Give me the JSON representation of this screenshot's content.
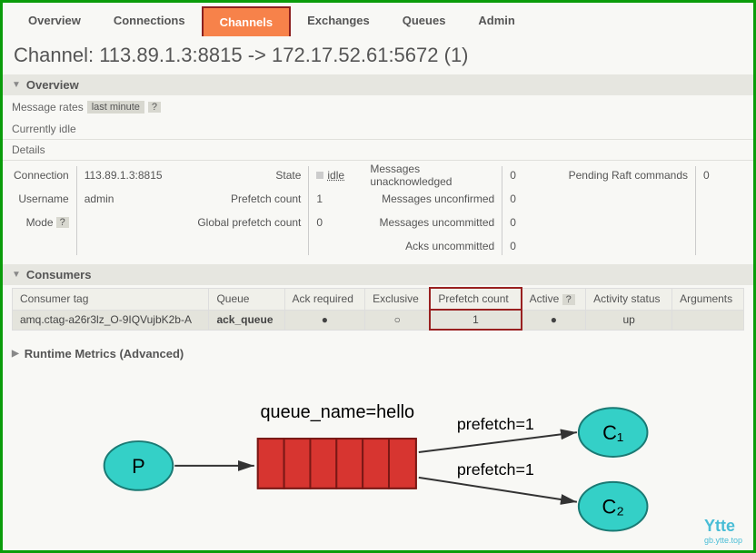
{
  "nav": {
    "items": [
      "Overview",
      "Connections",
      "Channels",
      "Exchanges",
      "Queues",
      "Admin"
    ],
    "active_index": 2
  },
  "heading_prefix": "Channel: ",
  "heading_value": "113.89.1.3:8815 -> 172.17.52.61:5672 (1)",
  "section_overview": "Overview",
  "msg_rates_label": "Message rates",
  "msg_rates_period": "last minute",
  "help": "?",
  "idle_text": "Currently idle",
  "details_label": "Details",
  "details": {
    "connection_label": "Connection",
    "connection": "113.89.1.3:8815",
    "username_label": "Username",
    "username": "admin",
    "mode_label": "Mode",
    "state_label": "State",
    "state": "idle",
    "prefetch_label": "Prefetch count",
    "prefetch": "1",
    "global_prefetch_label": "Global prefetch count",
    "global_prefetch": "0",
    "msgs_unack_label": "Messages unacknowledged",
    "msgs_unack": "0",
    "msgs_unconf_label": "Messages unconfirmed",
    "msgs_unconf": "0",
    "msgs_uncomm_label": "Messages uncommitted",
    "msgs_uncomm": "0",
    "acks_uncomm_label": "Acks uncommitted",
    "acks_uncomm": "0",
    "pending_raft_label": "Pending Raft commands",
    "pending_raft": "0"
  },
  "section_consumers": "Consumers",
  "consumers_headers": [
    "Consumer tag",
    "Queue",
    "Ack required",
    "Exclusive",
    "Prefetch count",
    "Active",
    "Activity status",
    "Arguments"
  ],
  "consumers_row": {
    "tag": "amq.ctag-a26r3lz_O-9IQVujbK2b-A",
    "queue": "ack_queue",
    "ack_required": "●",
    "exclusive": "○",
    "prefetch": "1",
    "active": "●",
    "activity": "up",
    "arguments": ""
  },
  "section_runtime": "Runtime Metrics (Advanced)",
  "chart_data": {
    "type": "diagram",
    "queue_label": "queue_name=hello",
    "producer": "P",
    "consumers": [
      "C₁",
      "C₂"
    ],
    "edge_labels": [
      "prefetch=1",
      "prefetch=1"
    ]
  },
  "watermark": "Ytte",
  "watermark_sub": "gb.ytte.top"
}
